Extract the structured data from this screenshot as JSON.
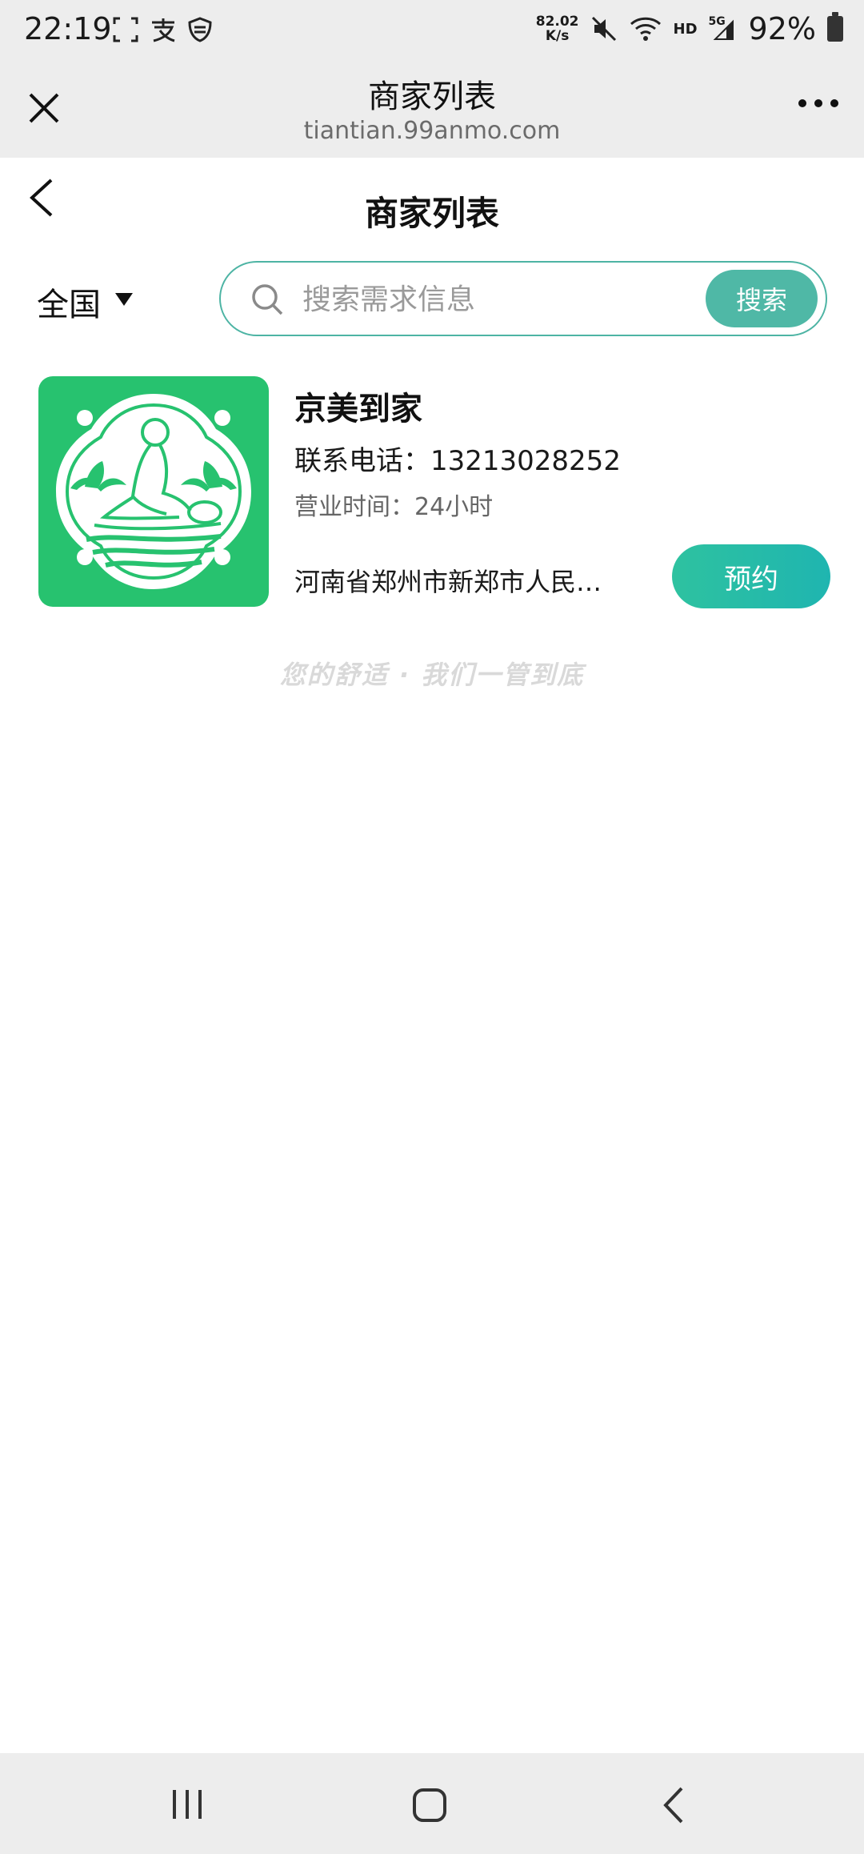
{
  "status_bar": {
    "time": "22:19",
    "net_speed_value": "82.02",
    "net_speed_unit": "K/s",
    "hd_label": "HD",
    "network_label": "5G",
    "battery_percent": "92%",
    "icons": [
      "screenshot-frame-icon",
      "alipay-icon",
      "shield-icon",
      "mute-icon",
      "wifi-icon",
      "signal-icon",
      "battery-icon"
    ]
  },
  "browser_header": {
    "title": "商家列表",
    "url": "tiantian.99anmo.com"
  },
  "page_header": {
    "title": "商家列表"
  },
  "filter": {
    "region": "全国"
  },
  "search": {
    "placeholder": "搜索需求信息",
    "button_label": "搜索"
  },
  "merchants": [
    {
      "name": "京美到家",
      "phone": "联系电话：13213028252",
      "hours": "营业时间：24小时",
      "address": "河南省郑州市新郑市人民…",
      "book_label": "预约"
    }
  ],
  "slogan": "您的舒适  ·  我们一管到底",
  "colors": {
    "accent": "#4fb8a6",
    "logo_green": "#27c26f",
    "bar_gray": "#ededed"
  }
}
